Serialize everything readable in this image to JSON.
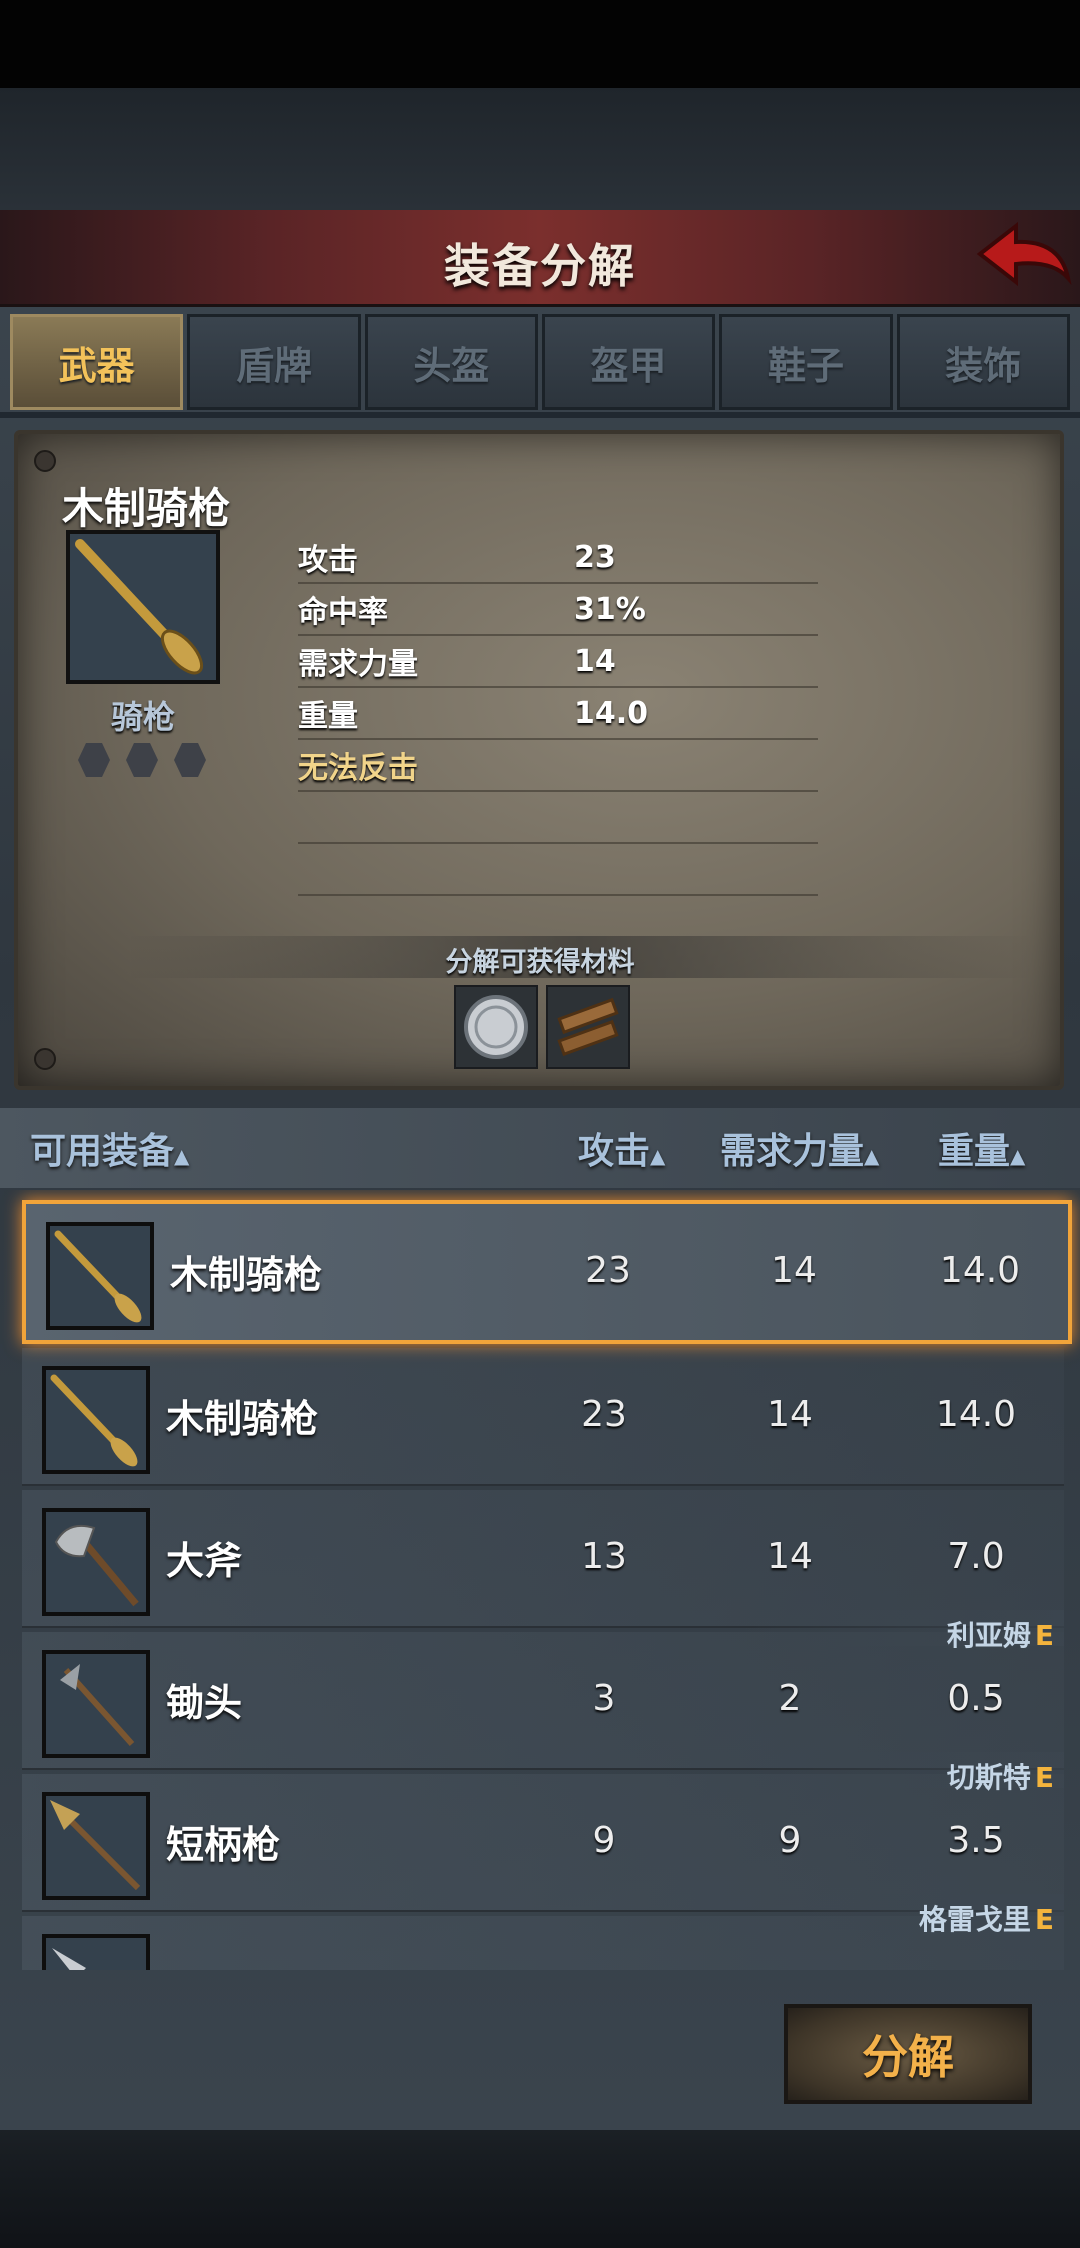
{
  "header": {
    "title": "装备分解"
  },
  "tabs": [
    {
      "label": "武器",
      "active": true
    },
    {
      "label": "盾牌"
    },
    {
      "label": "头盔"
    },
    {
      "label": "盔甲"
    },
    {
      "label": "鞋子"
    },
    {
      "label": "装饰"
    }
  ],
  "detail": {
    "name": "木制骑枪",
    "type": "骑枪",
    "stats": [
      {
        "k": "攻击",
        "v": "23"
      },
      {
        "k": "命中率",
        "v": "31%"
      },
      {
        "k": "需求力量",
        "v": "14"
      },
      {
        "k": "重量",
        "v": "14.0"
      }
    ],
    "note": "无法反击",
    "materials_title": "分解可获得材料",
    "materials": [
      "silver-coin-icon",
      "wood-planks-icon"
    ]
  },
  "list": {
    "headers": {
      "name": "可用装备",
      "attack": "攻击",
      "strength": "需求力量",
      "weight": "重量",
      "sort_mark": "▲"
    },
    "rows": [
      {
        "name": "木制骑枪",
        "attack": "23",
        "strength": "14",
        "weight": "14.0",
        "owner": "",
        "icon": "lance-icon",
        "selected": true
      },
      {
        "name": "木制骑枪",
        "attack": "23",
        "strength": "14",
        "weight": "14.0",
        "owner": "",
        "icon": "lance-icon"
      },
      {
        "name": "大斧",
        "attack": "13",
        "strength": "14",
        "weight": "7.0",
        "owner": "",
        "icon": "great-axe-icon"
      },
      {
        "name": "锄头",
        "attack": "3",
        "strength": "2",
        "weight": "0.5",
        "owner": "利亚姆",
        "owner_tag": "E",
        "icon": "hoe-icon"
      },
      {
        "name": "短柄枪",
        "attack": "9",
        "strength": "9",
        "weight": "3.5",
        "owner": "切斯特",
        "owner_tag": "E",
        "icon": "short-spear-icon"
      },
      {
        "name": "",
        "attack": "",
        "strength": "",
        "weight": "",
        "owner": "格雷戈里",
        "owner_tag": "E",
        "icon": "dagger-icon"
      }
    ]
  },
  "footer": {
    "decompose_label": "分解"
  },
  "colors": {
    "accent": "#f3b14a",
    "selected_border": "#f1a43a",
    "tab_active": "#f3c25a"
  }
}
